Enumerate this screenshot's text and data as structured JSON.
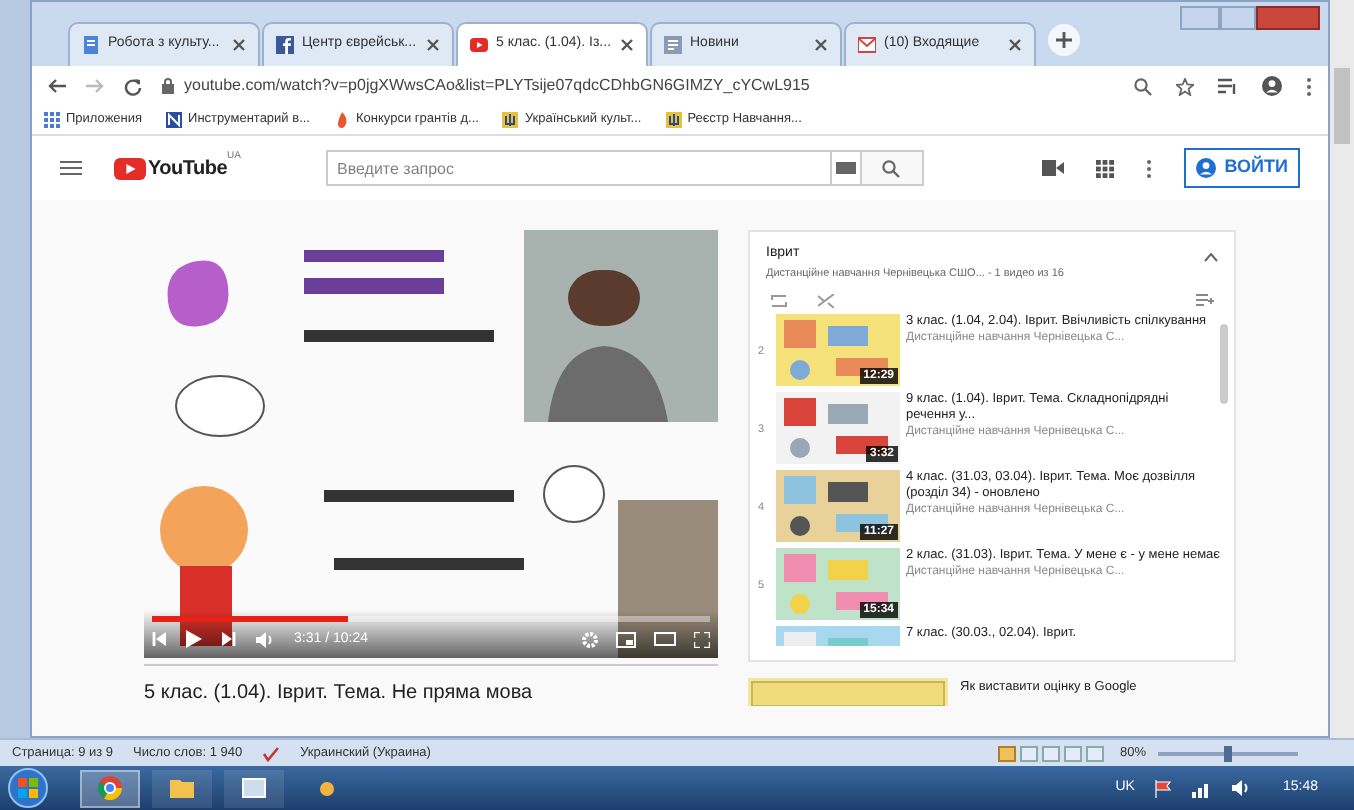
{
  "browser": {
    "tabs": [
      {
        "label": "Робота з культу...",
        "kind": "doc",
        "selected": false
      },
      {
        "label": "Центр єврейськ...",
        "kind": "facebook",
        "selected": false
      },
      {
        "label": "5 клас. (1.04). Із...",
        "kind": "youtube",
        "selected": true
      },
      {
        "label": "Новини",
        "kind": "news",
        "selected": false
      },
      {
        "label": "(10) Входящие",
        "kind": "mail",
        "selected": false
      }
    ],
    "address": "youtube.com/watch?v=p0jgXWwsCAo&list=PLYTsije07qdcCDhbGN6GIMZY_cYCwL915",
    "bookmarks": [
      {
        "label": "Приложения",
        "kind": "apps"
      },
      {
        "label": "Инструментарий в...",
        "kind": "square"
      },
      {
        "label": "Конкурси грантів д...",
        "kind": "flame"
      },
      {
        "label": "Український культ...",
        "kind": "emblem"
      },
      {
        "label": "Реєстр Навчання...",
        "kind": "emblem"
      }
    ]
  },
  "youtube": {
    "logo": "YouTube",
    "region": "UA",
    "search_placeholder": "Введите запрос",
    "sign_in": "ВОЙТИ"
  },
  "player": {
    "time": "3:31 / 10:24",
    "level": 0.35,
    "title": "5 клас. (1.04). Іврит. Тема. Не пряма мова"
  },
  "playlist": {
    "title": "Іврит",
    "subtitle": "Дистанційне навчання Чернівецька СШО... - 1 видео из 16",
    "items": [
      {
        "index": "2",
        "title": "3 клас. (1.04, 2.04). Іврит. Ввічливість спілкування",
        "channel": "Дистанційне навчання Чернівецька С...",
        "duration": "12:29"
      },
      {
        "index": "3",
        "title": "9 клас. (1.04). Іврит. Тема. Складнопідрядні речення у...",
        "channel": "Дистанційне навчання Чернівецька С...",
        "duration": "3:32"
      },
      {
        "index": "4",
        "title": "4 клас. (31.03, 03.04). Іврит. Тема. Моє дозвілля (розділ 34) - оновлено",
        "channel": "Дистанційне навчання Чернівецька С...",
        "duration": "11:27"
      },
      {
        "index": "5",
        "title": "2 клас. (31.03). Іврит. Тема. У мене є - у мене немає",
        "channel": "Дистанційне навчання Чернівецька С...",
        "duration": "15:34"
      },
      {
        "title": "7 клас. (30.03., 02.04). Іврит."
      }
    ]
  },
  "recommended": {
    "title": "Як виставити оцінку в Google"
  },
  "word_status": {
    "page": "Страница: 9 из 9",
    "words": "Число слов: 1 940",
    "language": "Украинский (Украина)",
    "zoom": "80%",
    "level": 0.5
  },
  "taskbar": {
    "language": "UK",
    "time": "15:48"
  }
}
